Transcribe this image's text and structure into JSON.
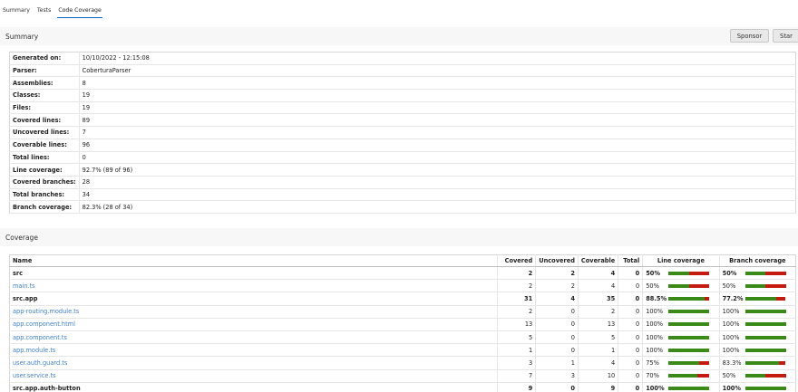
{
  "tabs": [
    "Summary",
    "Tests",
    "Code Coverage"
  ],
  "summary_section": {
    "title": "Summary",
    "sponsor_label": "Sponsor",
    "star_label": "Star"
  },
  "summary": [
    {
      "label": "Generated on:",
      "value": "10/10/2022 - 12:15:08"
    },
    {
      "label": "Parser:",
      "value": "CoberturaParser"
    },
    {
      "label": "Assemblies:",
      "value": "8"
    },
    {
      "label": "Classes:",
      "value": "19"
    },
    {
      "label": "Files:",
      "value": "19"
    },
    {
      "label": "Covered lines:",
      "value": "89"
    },
    {
      "label": "Uncovered lines:",
      "value": "7"
    },
    {
      "label": "Coverable lines:",
      "value": "96"
    },
    {
      "label": "Total lines:",
      "value": "0"
    },
    {
      "label": "Line coverage:",
      "value": "92.7% (89 of 96)"
    },
    {
      "label": "Covered branches:",
      "value": "28"
    },
    {
      "label": "Total branches:",
      "value": "34"
    },
    {
      "label": "Branch coverage:",
      "value": "82.3% (28 of 34)"
    }
  ],
  "coverage_section": {
    "title": "Coverage"
  },
  "coverage_table": {
    "headers": {
      "name": "Name",
      "covered": "Covered",
      "uncovered": "Uncovered",
      "coverable": "Coverable",
      "total": "Total",
      "line_coverage": "Line coverage",
      "branch_coverage": "Branch coverage"
    },
    "rows": [
      {
        "name": "src",
        "group": true,
        "covered": "2",
        "uncovered": "2",
        "coverable": "4",
        "total": "0",
        "line_pct": "50%",
        "line_fill": 0.5,
        "branch_pct": "50%",
        "branch_fill": 0.5
      },
      {
        "name": "main.ts",
        "group": false,
        "covered": "2",
        "uncovered": "2",
        "coverable": "4",
        "total": "0",
        "line_pct": "50%",
        "line_fill": 0.5,
        "branch_pct": "50%",
        "branch_fill": 0.5
      },
      {
        "name": "src.app",
        "group": true,
        "covered": "31",
        "uncovered": "4",
        "coverable": "35",
        "total": "0",
        "line_pct": "88.5%",
        "line_fill": 0.885,
        "branch_pct": "77.2%",
        "branch_fill": 0.772
      },
      {
        "name": "app-routing.module.ts",
        "group": false,
        "covered": "2",
        "uncovered": "0",
        "coverable": "2",
        "total": "0",
        "line_pct": "100%",
        "line_fill": 1.0,
        "branch_pct": "100%",
        "branch_fill": 1.0
      },
      {
        "name": "app.component.html",
        "group": false,
        "covered": "13",
        "uncovered": "0",
        "coverable": "13",
        "total": "0",
        "line_pct": "100%",
        "line_fill": 1.0,
        "branch_pct": "100%",
        "branch_fill": 1.0
      },
      {
        "name": "app.component.ts",
        "group": false,
        "covered": "5",
        "uncovered": "0",
        "coverable": "5",
        "total": "0",
        "line_pct": "100%",
        "line_fill": 1.0,
        "branch_pct": "100%",
        "branch_fill": 1.0
      },
      {
        "name": "app.module.ts",
        "group": false,
        "covered": "1",
        "uncovered": "0",
        "coverable": "1",
        "total": "0",
        "line_pct": "100%",
        "line_fill": 1.0,
        "branch_pct": "100%",
        "branch_fill": 1.0
      },
      {
        "name": "user.auth.guard.ts",
        "group": false,
        "covered": "3",
        "uncovered": "1",
        "coverable": "4",
        "total": "0",
        "line_pct": "75%",
        "line_fill": 0.75,
        "branch_pct": "83.3%",
        "branch_fill": 0.833
      },
      {
        "name": "user.service.ts",
        "group": false,
        "covered": "7",
        "uncovered": "3",
        "coverable": "10",
        "total": "0",
        "line_pct": "70%",
        "line_fill": 0.7,
        "branch_pct": "50%",
        "branch_fill": 0.5
      },
      {
        "name": "src.app.auth-button",
        "group": true,
        "covered": "9",
        "uncovered": "0",
        "coverable": "9",
        "total": "0",
        "line_pct": "100%",
        "line_fill": 1.0,
        "branch_pct": "100%",
        "branch_fill": 1.0
      }
    ]
  },
  "colors": {
    "covered": "#3a8a18",
    "uncovered": "#c51a10",
    "link": "#3f80c9",
    "tab_active": "#0b63c4"
  }
}
